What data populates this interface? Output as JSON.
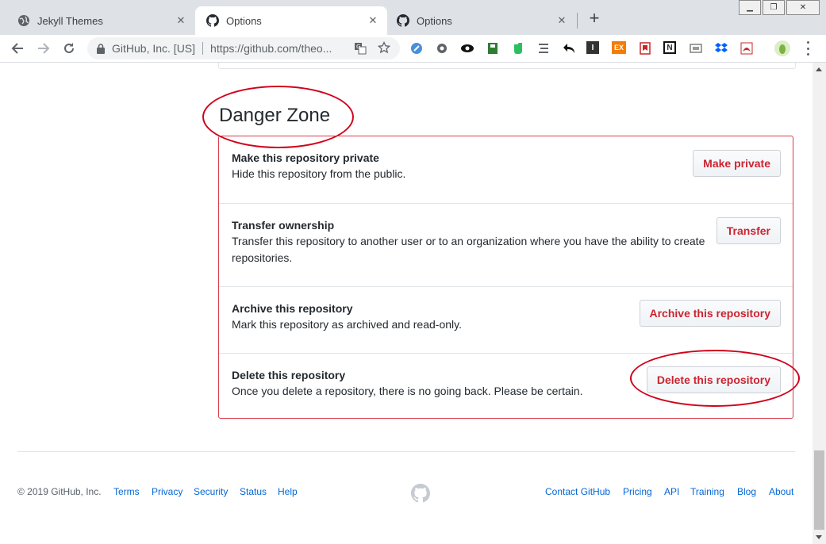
{
  "browser": {
    "tabs": [
      {
        "title": "Jekyll Themes",
        "icon": "globe-icon",
        "active": false
      },
      {
        "title": "Options",
        "icon": "github-icon",
        "active": true
      },
      {
        "title": "Options",
        "icon": "github-icon",
        "active": false
      }
    ],
    "new_tab_label": "+",
    "address": {
      "org": "GitHub, Inc. [US]",
      "url": "https://github.com/theo..."
    },
    "extensions": [
      "ext-1",
      "ext-2",
      "ext-eye",
      "ext-4",
      "evernote",
      "ext-6",
      "ext-back",
      "I",
      "EX",
      "ext-10",
      "N",
      "ext-12",
      "dropbox",
      "acrobat",
      "profile"
    ]
  },
  "danger_zone": {
    "heading": "Danger Zone",
    "items": [
      {
        "title": "Make this repository private",
        "description": "Hide this repository from the public.",
        "button": "Make private"
      },
      {
        "title": "Transfer ownership",
        "description": "Transfer this repository to another user or to an organization where you have the ability to create repositories.",
        "button": "Transfer"
      },
      {
        "title": "Archive this repository",
        "description": "Mark this repository as archived and read-only.",
        "button": "Archive this repository"
      },
      {
        "title": "Delete this repository",
        "description": "Once you delete a repository, there is no going back. Please be certain.",
        "button": "Delete this repository"
      }
    ]
  },
  "footer": {
    "copyright": "© 2019 GitHub, Inc.",
    "left_links": [
      "Terms",
      "Privacy",
      "Security",
      "Status",
      "Help"
    ],
    "right_links": [
      "Contact GitHub",
      "Pricing",
      "API",
      "Training",
      "Blog",
      "About"
    ]
  },
  "colors": {
    "danger": "#cb2431",
    "danger_border": "#d73a49",
    "annotation": "#d0021b",
    "link": "#0366d6"
  }
}
